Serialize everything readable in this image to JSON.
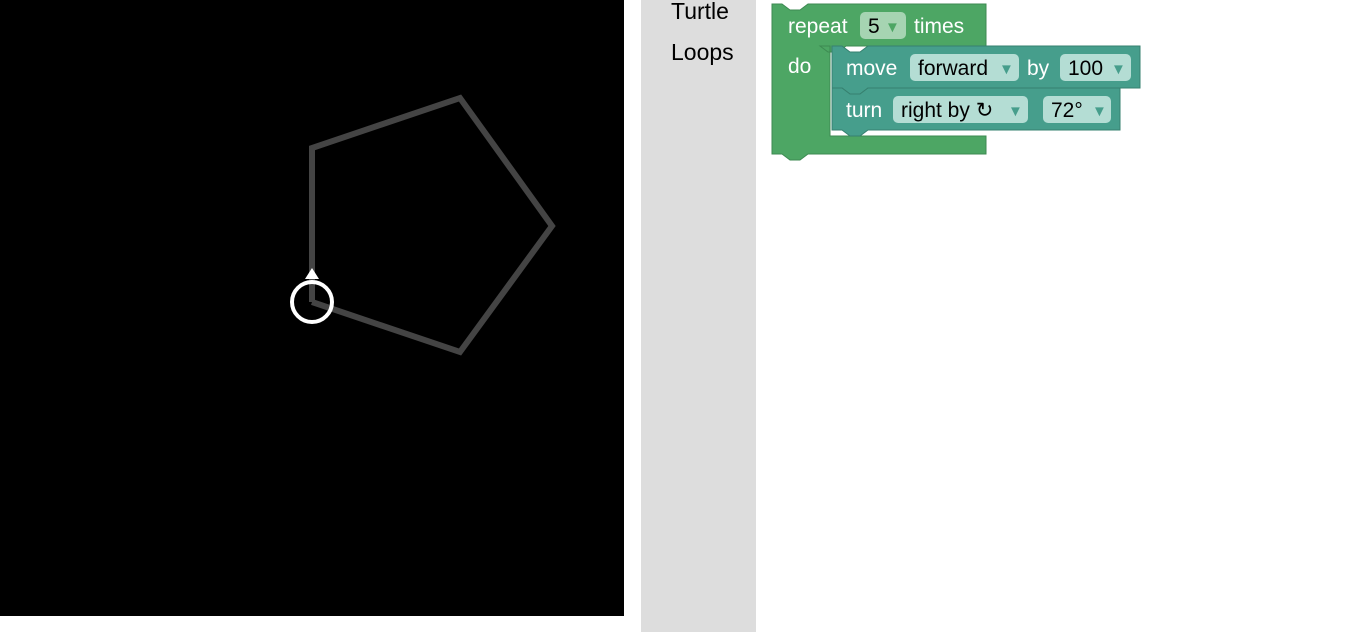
{
  "canvas": {
    "background": "#000000",
    "path_color": "#444444",
    "turtle_color": "#ffffff"
  },
  "toolbox": {
    "categories": [
      {
        "label": "Turtle"
      },
      {
        "label": "Loops"
      }
    ]
  },
  "workspace": {
    "loop_color": "#4da664",
    "turtle_block_color": "#469e8c",
    "repeat_block": {
      "keyword": "repeat",
      "count": "5",
      "suffix": "times",
      "do_label": "do"
    },
    "move_block": {
      "keyword": "move",
      "direction": "forward",
      "by_label": "by",
      "distance": "100"
    },
    "turn_block": {
      "keyword": "turn",
      "direction": "right by ↻",
      "angle": "72°"
    },
    "dropdown_arrow": "▼"
  }
}
